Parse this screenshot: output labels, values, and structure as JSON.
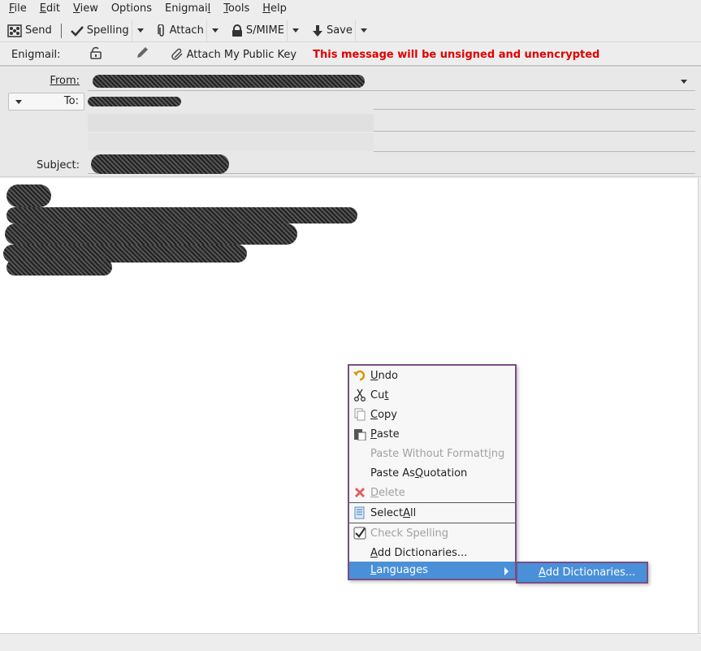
{
  "menubar": {
    "items": [
      {
        "pre": "",
        "acc": "F",
        "post": "ile"
      },
      {
        "pre": "",
        "acc": "E",
        "post": "dit"
      },
      {
        "pre": "",
        "acc": "V",
        "post": "iew"
      },
      {
        "pre": "Options",
        "acc": "",
        "post": ""
      },
      {
        "pre": "Enigmai",
        "acc": "l",
        "post": ""
      },
      {
        "pre": "",
        "acc": "T",
        "post": "ools"
      },
      {
        "pre": "",
        "acc": "H",
        "post": "elp"
      }
    ]
  },
  "toolbar": {
    "send": "Send",
    "spelling": "Spelling",
    "attach": "Attach",
    "smime": "S/MIME",
    "save": "Save"
  },
  "enigmail": {
    "label": "Enigmail:",
    "attach_key": "Attach My Public Key",
    "warning": "This message will be unsigned and unencrypted"
  },
  "header": {
    "from_label": "From:",
    "to_label": "To:",
    "subject_label": "Subject:"
  },
  "context_menu": {
    "undo": {
      "pre": "",
      "acc": "U",
      "post": "ndo"
    },
    "cut": {
      "pre": "Cu",
      "acc": "t",
      "post": ""
    },
    "copy": {
      "pre": "",
      "acc": "C",
      "post": "opy"
    },
    "paste": {
      "pre": "",
      "acc": "P",
      "post": "aste"
    },
    "paste_without_formatting": {
      "pre": "Paste Without Formatt",
      "acc": "i",
      "post": "ng"
    },
    "paste_as_quotation": {
      "pre": "Paste As ",
      "acc": "Q",
      "post": "uotation"
    },
    "delete": {
      "pre": "",
      "acc": "D",
      "post": "elete"
    },
    "select_all": {
      "pre": "Select ",
      "acc": "A",
      "post": "ll"
    },
    "check_spelling": {
      "pre": "Check Spellin",
      "acc": "g",
      "post": ""
    },
    "add_dictionaries": {
      "pre": "",
      "acc": "A",
      "post": "dd Dictionaries..."
    },
    "languages": {
      "pre": "",
      "acc": "L",
      "post": "anguages"
    }
  },
  "submenu": {
    "add_dictionaries": {
      "pre": "",
      "acc": "A",
      "post": "dd Dictionaries..."
    }
  }
}
